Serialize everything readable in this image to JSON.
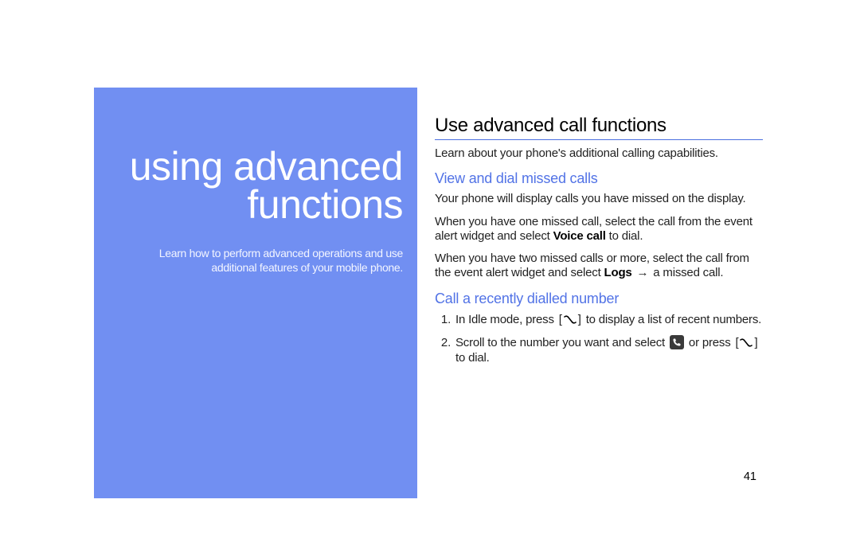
{
  "left": {
    "title_line1": "using advanced",
    "title_line2": "functions",
    "sub_line1": "Learn how to perform advanced operations and use",
    "sub_line2": "additional features of your mobile phone."
  },
  "right": {
    "h1": "Use advanced call functions",
    "intro": "Learn about your phone's additional calling capabilities.",
    "sec1": {
      "title": "View and dial missed calls",
      "p1": "Your phone will display calls you have missed on the display.",
      "p2a": "When you have one missed call, select the call from the event alert widget and select ",
      "p2b": "Voice call",
      "p2c": " to dial.",
      "p3a": "When you have two missed calls or more, select the call from the event alert widget and select ",
      "p3b": "Logs",
      "p3c": " a missed call."
    },
    "sec2": {
      "title": "Call a recently dialled number",
      "s1a": "In Idle mode, press ",
      "s1b": " to display a list of recent numbers.",
      "s2a": "Scroll to the number you want and select ",
      "s2b": " or press ",
      "s2c": " to dial."
    }
  },
  "page_number": "41",
  "arrow_glyph": "→"
}
